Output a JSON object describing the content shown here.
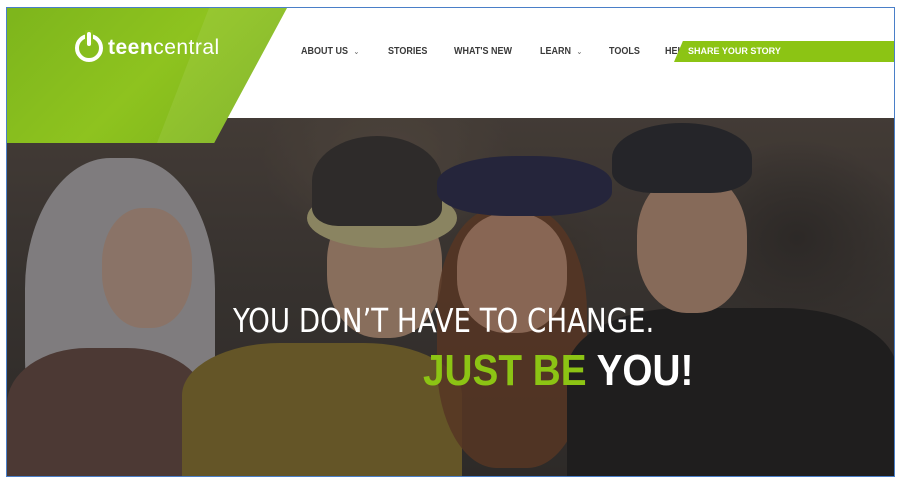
{
  "brand": {
    "name_bold": "teen",
    "name_regular": "central",
    "accent_color": "#8cc414"
  },
  "nav": {
    "items": [
      {
        "label": "ABOUT US",
        "has_dropdown": true
      },
      {
        "label": "STORIES",
        "has_dropdown": false
      },
      {
        "label": "WHAT'S NEW",
        "has_dropdown": false
      },
      {
        "label": "LEARN",
        "has_dropdown": true
      },
      {
        "label": "TOOLS",
        "has_dropdown": false
      },
      {
        "label": "HELP",
        "has_dropdown": false
      }
    ],
    "cta_label": "SHARE YOUR STORY",
    "dropdown_glyph": "⌄"
  },
  "hero": {
    "line1": "YOU DON’T HAVE TO CHANGE.",
    "line2_green": "JUST BE ",
    "line2_white": "YOU!"
  }
}
